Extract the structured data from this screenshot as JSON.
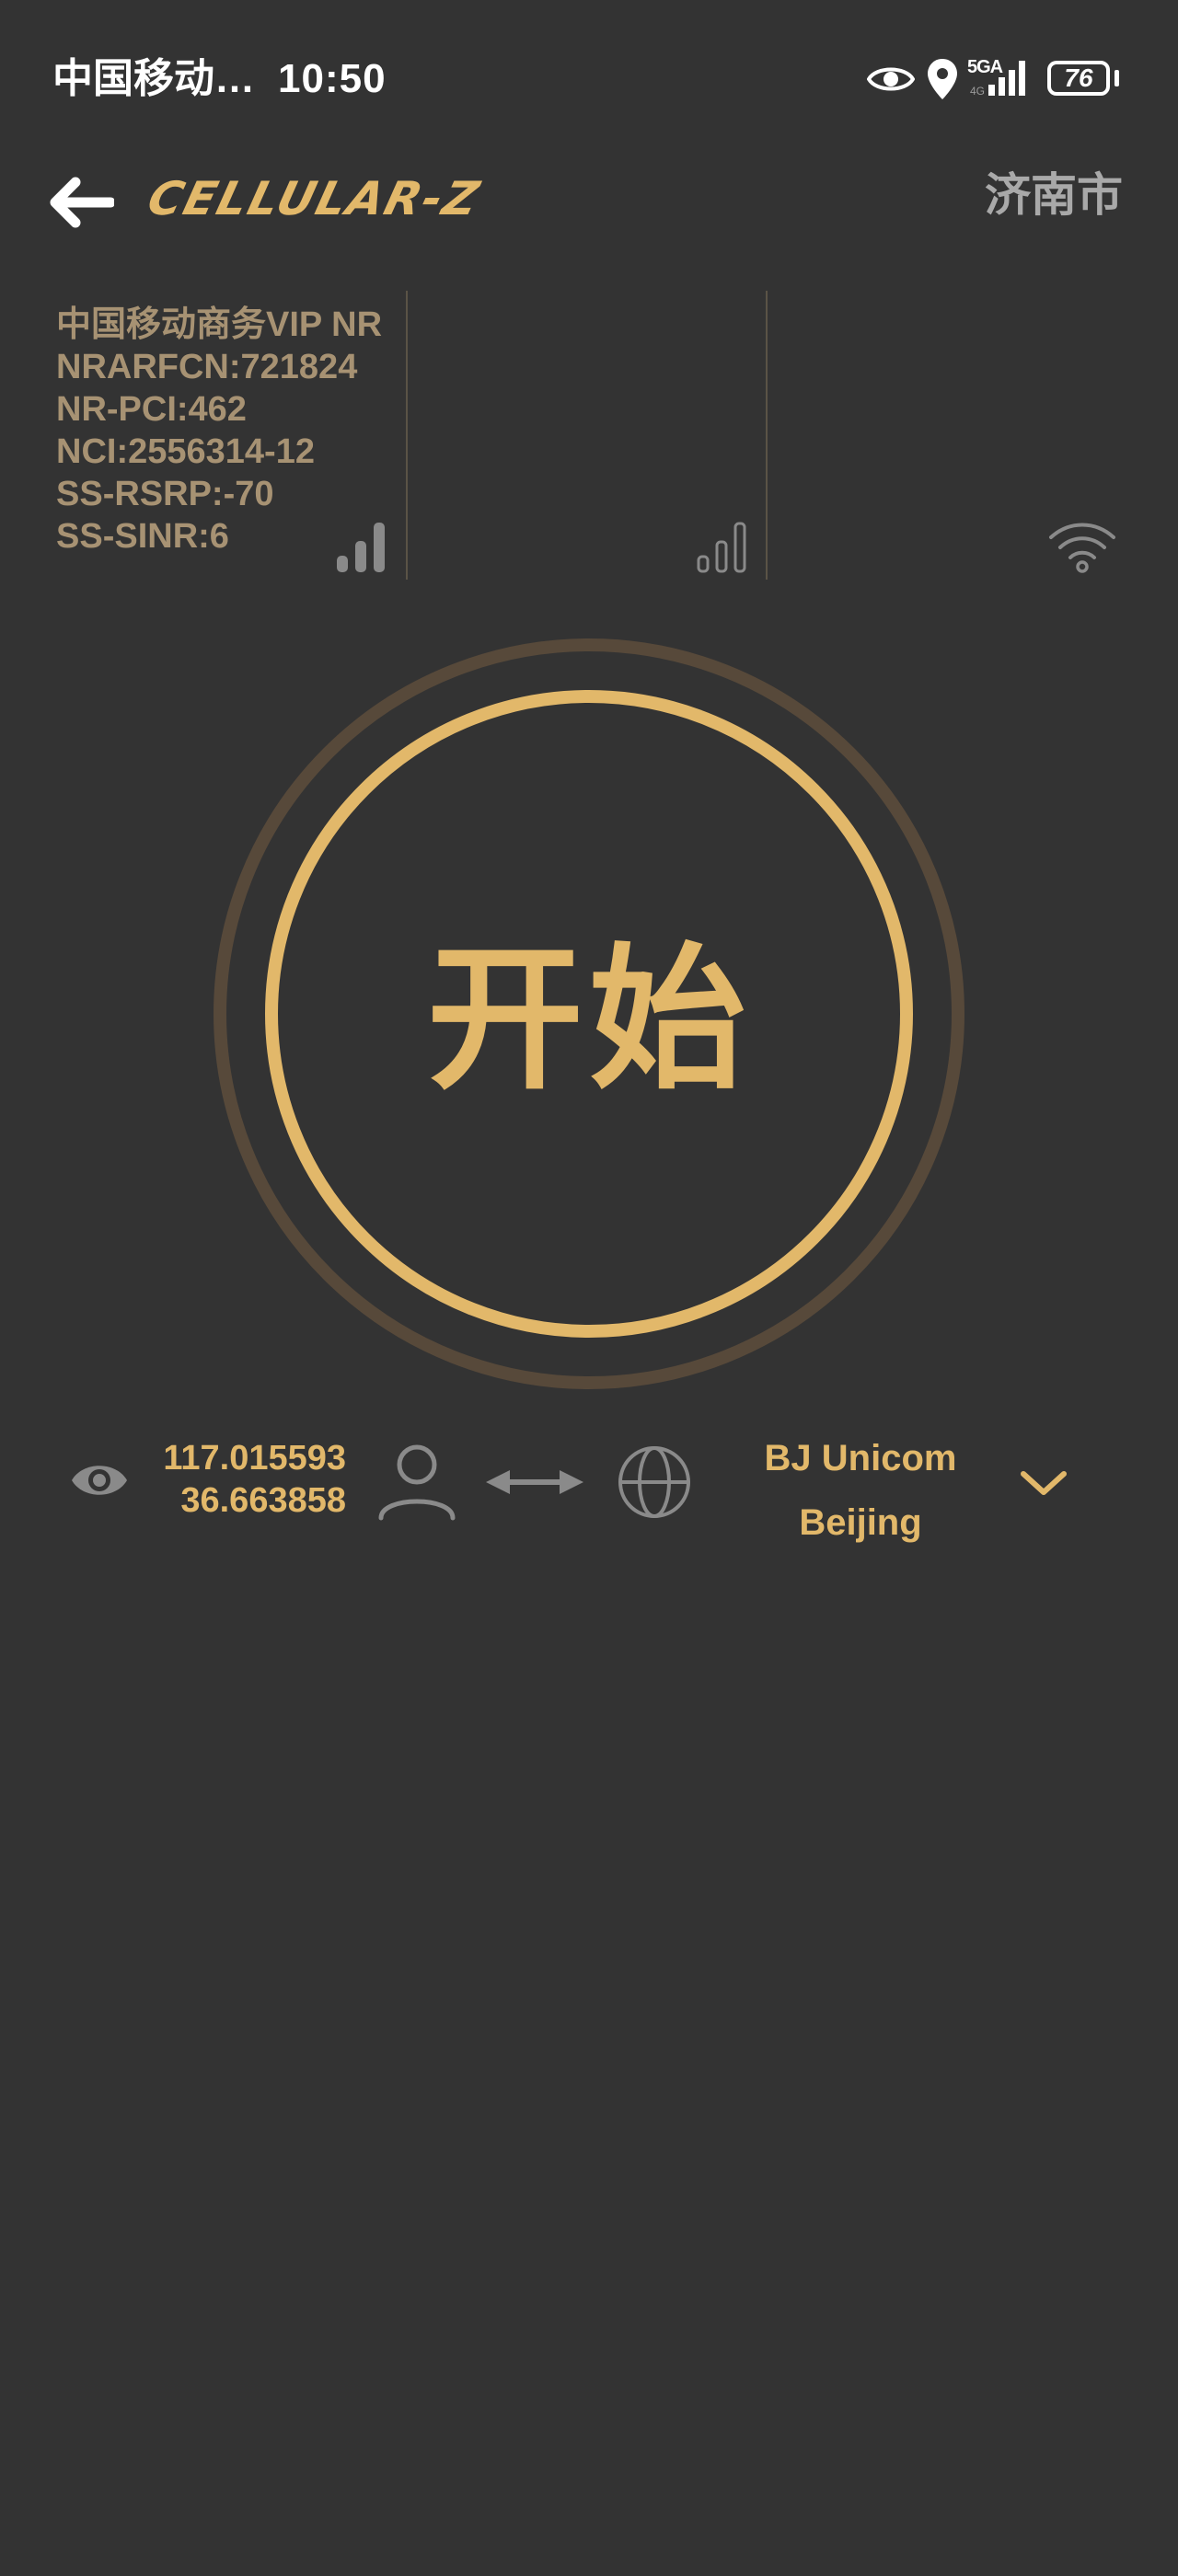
{
  "status_bar": {
    "carrier": "中国移动…",
    "time": "10:50",
    "network_label": "5GA",
    "network_sub": "4G",
    "battery": "76"
  },
  "header": {
    "logo": "CELLULAR-Z",
    "city": "济南市"
  },
  "signal": {
    "lines": [
      "中国移动商务VIP NR",
      "NRARFCN:721824",
      "NR-PCI:462",
      "NCI:2556314-12",
      "SS-RSRP:-70",
      "SS-SINR:6"
    ]
  },
  "start_button": {
    "label": "开始"
  },
  "location": {
    "longitude": "117.015593",
    "latitude": "36.663858"
  },
  "server": {
    "name": "BJ Unicom",
    "city": "Beijing"
  },
  "icons": {
    "back": "back-arrow-icon",
    "eye": "eye-icon",
    "user": "user-icon",
    "swap": "swap-arrows-icon",
    "globe": "globe-icon",
    "chevron": "chevron-down-icon",
    "wifi": "wifi-icon",
    "signal": "signal-bars-icon"
  },
  "colors": {
    "background": "#333333",
    "accent": "#e2b86a",
    "muted_gold": "#a79273",
    "ring_dark": "#57493a",
    "gray": "#8a8a8a"
  }
}
